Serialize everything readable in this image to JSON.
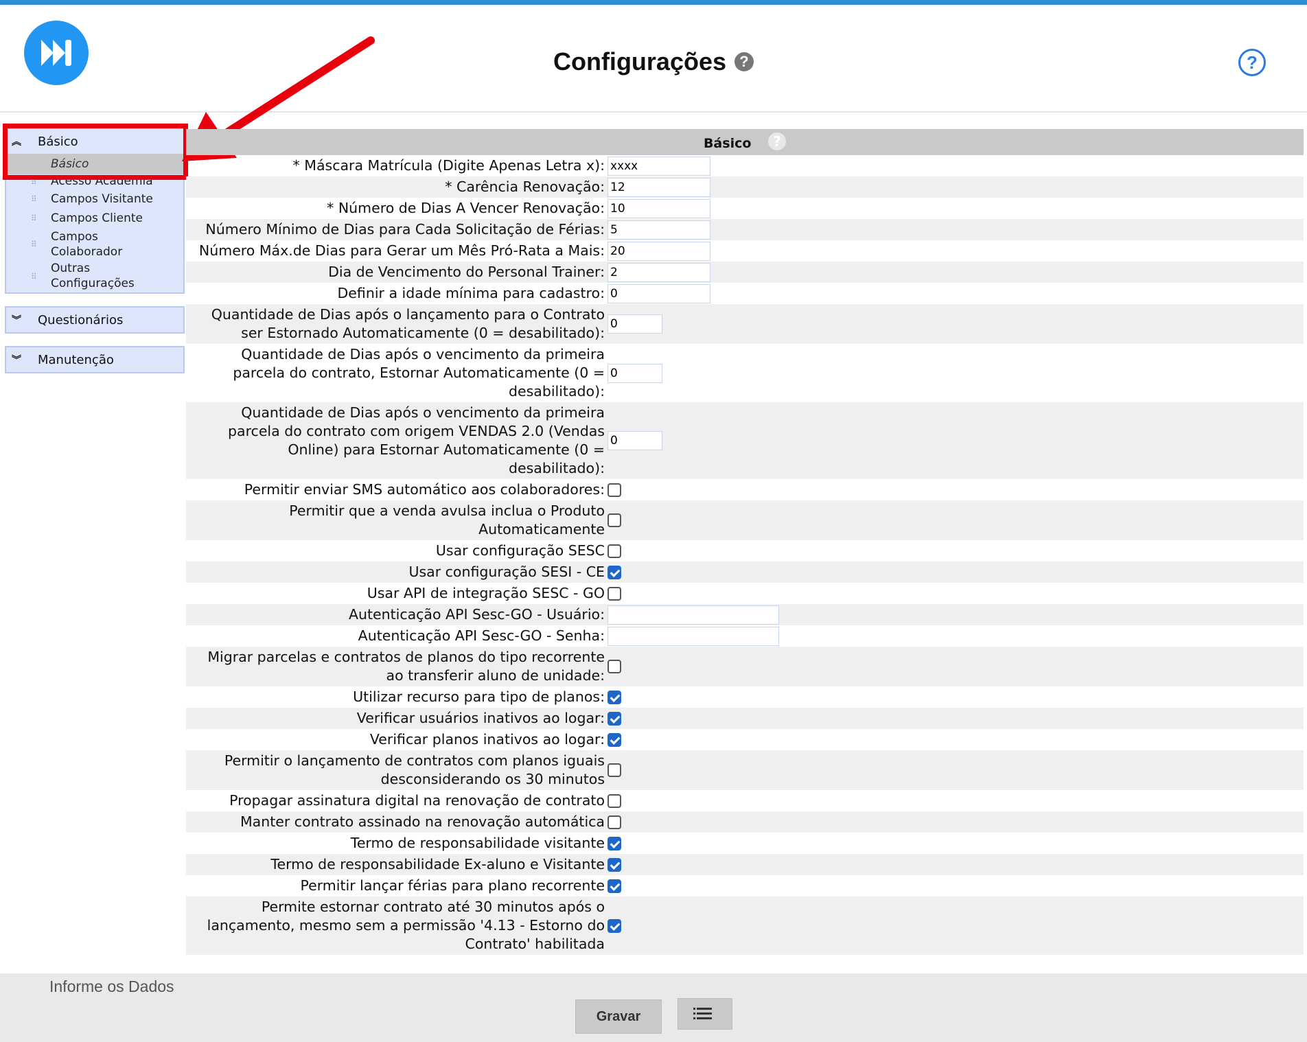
{
  "header": {
    "title": "Configurações",
    "title_help": "?",
    "help_icon": "?"
  },
  "sidebar": {
    "panels": [
      {
        "label": "Básico",
        "expanded": true,
        "items": [
          "Básico",
          "Acesso Academia",
          "Campos Visitante",
          "Campos Cliente",
          "Campos Colaborador",
          "Outras Configurações"
        ],
        "selected": "Básico"
      },
      {
        "label": "Questionários",
        "expanded": false
      },
      {
        "label": "Manutenção",
        "expanded": false
      }
    ]
  },
  "form": {
    "section_title": "Básico",
    "section_help": "?",
    "fields": [
      {
        "label": "* Máscara Matrícula (Digite Apenas Letra x):",
        "type": "text",
        "value": "xxxx"
      },
      {
        "label": "* Carência Renovação:",
        "type": "text",
        "value": "12"
      },
      {
        "label": "* Número de Dias A Vencer Renovação:",
        "type": "text",
        "value": "10"
      },
      {
        "label": "Número Mínimo de Dias para Cada Solicitação de Férias:",
        "type": "text",
        "value": "5"
      },
      {
        "label": "Número Máx.de Dias para Gerar um Mês Pró-Rata a Mais:",
        "type": "text",
        "value": "20"
      },
      {
        "label": "Dia de Vencimento do Personal Trainer:",
        "type": "text",
        "value": "2"
      },
      {
        "label": "Definir a idade mínima para cadastro:",
        "type": "text",
        "value": "0"
      },
      {
        "label": "Quantidade de Dias após o lançamento para o Contrato ser Estornado Automaticamente (0 = desabilitado):",
        "type": "text",
        "value": "0"
      },
      {
        "label": "Quantidade de Dias após o vencimento da primeira parcela do contrato, Estornar Automaticamente (0 = desabilitado):",
        "type": "text",
        "value": "0"
      },
      {
        "label": "Quantidade de Dias após o vencimento da primeira parcela do contrato com origem VENDAS 2.0 (Vendas Online) para Estornar Automaticamente (0 = desabilitado):",
        "type": "text",
        "value": "0"
      },
      {
        "label": "Permitir enviar SMS automático aos colaboradores:",
        "type": "checkbox",
        "checked": false
      },
      {
        "label": "Permitir que a venda avulsa inclua o Produto Automaticamente",
        "type": "checkbox",
        "checked": false
      },
      {
        "label": "Usar configuração SESC",
        "type": "checkbox",
        "checked": false
      },
      {
        "label": "Usar configuração SESI - CE",
        "type": "checkbox",
        "checked": true
      },
      {
        "label": "Usar API de integração SESC - GO",
        "type": "checkbox",
        "checked": false
      },
      {
        "label": "Autenticação API Sesc-GO - Usuário:",
        "type": "text",
        "value": ""
      },
      {
        "label": "Autenticação API Sesc-GO - Senha:",
        "type": "text",
        "value": ""
      },
      {
        "label": "Migrar parcelas e contratos de planos do tipo recorrente ao transferir aluno de unidade:",
        "type": "checkbox",
        "checked": false
      },
      {
        "label": "Utilizar recurso para tipo de planos:",
        "type": "checkbox",
        "checked": true
      },
      {
        "label": "Verificar usuários inativos ao logar:",
        "type": "checkbox",
        "checked": true
      },
      {
        "label": "Verificar planos inativos ao logar:",
        "type": "checkbox",
        "checked": true
      },
      {
        "label": "Permitir o lançamento de contratos com planos iguais desconsiderando os 30 minutos",
        "type": "checkbox",
        "checked": false
      },
      {
        "label": "Propagar assinatura digital na renovação de contrato",
        "type": "checkbox",
        "checked": false
      },
      {
        "label": "Manter contrato assinado na renovação automática",
        "type": "checkbox",
        "checked": false
      },
      {
        "label": "Termo de responsabilidade visitante",
        "type": "checkbox",
        "checked": true
      },
      {
        "label": "Termo de responsabilidade Ex-aluno e Visitante",
        "type": "checkbox",
        "checked": true
      },
      {
        "label": "Permitir lançar férias para plano recorrente",
        "type": "checkbox",
        "checked": true
      },
      {
        "label": "Permite estornar contrato até 30 minutos após o lançamento, mesmo sem a permissão '4.13 - Estorno do Contrato' habilitada",
        "type": "checkbox",
        "checked": true
      }
    ]
  },
  "footer": {
    "note": "Informe os Dados",
    "save_label": "Gravar"
  },
  "colors": {
    "accent": "#2d8fd0",
    "logo": "#2196f3",
    "annotation": "#e8000d",
    "checkbox_checked": "#1f66c9"
  }
}
